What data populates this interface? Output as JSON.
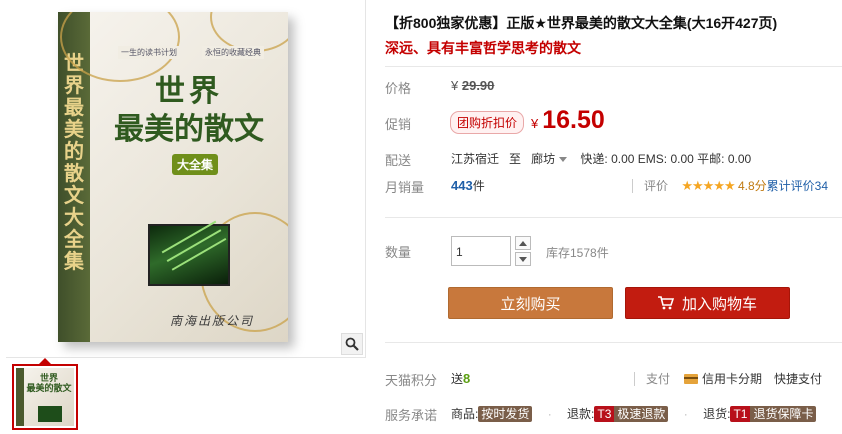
{
  "product": {
    "title": "【折800独家优惠】正版★世界最美的散文大全集(大16开427页)",
    "subtitle": "深远、具有丰富哲学思考的散文"
  },
  "cover": {
    "spine_text": "世界最美的散文大全集",
    "tag_left": "一生的读书计划",
    "tag_right": "永恒的收藏经典",
    "title_line1": "世界",
    "title_line2": "最美的散文",
    "badge": "大全集",
    "publisher": "南海出版公司"
  },
  "thumbnail": {
    "title_line1": "世界",
    "title_line2": "最美的散文"
  },
  "price": {
    "label": "价格",
    "currency": "¥",
    "original": "29.90"
  },
  "promo": {
    "label": "促销",
    "tag": "团购折扣价",
    "currency": "¥",
    "price": "16.50"
  },
  "shipping": {
    "label": "配送",
    "from": "江苏宿迁",
    "to_word": "至",
    "destination": "廊坊",
    "express": "快递: 0.00",
    "ems": "EMS: 0.00",
    "surface": "平邮: 0.00"
  },
  "sales": {
    "label": "月销量",
    "count": "443",
    "unit": "件"
  },
  "rating": {
    "label": "评价",
    "stars": 5,
    "score_text": "4.8分",
    "reviews_text": "累计评价34"
  },
  "quantity": {
    "label": "数量",
    "value": "1",
    "stock": "库存1578件"
  },
  "actions": {
    "buy_now": "立刻购买",
    "add_to_cart": "加入购物车"
  },
  "points": {
    "label": "天猫积分",
    "prefix": "送",
    "value": "8"
  },
  "payment": {
    "label": "支付",
    "credit": "信用卡分期",
    "fast": "快捷支付"
  },
  "service": {
    "label": "服务承诺",
    "item1_prefix": "商品:",
    "item1_badge": "按时发货",
    "item2_prefix": "退款:",
    "item2_code": "T3",
    "item2_badge": "极速退款",
    "item3_prefix": "退货:",
    "item3_code": "T1",
    "item3_badge": "退货保障卡"
  },
  "colors": {
    "accent_red": "#c40000",
    "buy_button": "#c8783c",
    "cart_button": "#c21c10",
    "link_blue": "#1f5fa8",
    "points_green": "#5b9e12"
  }
}
